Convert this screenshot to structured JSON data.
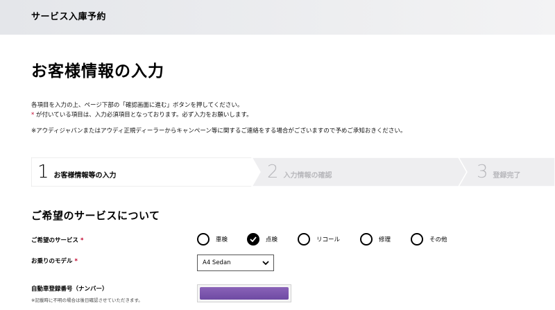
{
  "header": {
    "title": "サービス入庫予約"
  },
  "page": {
    "title": "お客様情報の入力",
    "intro_line1": "各項目を入力の上、ページ下部の「確認画面に進む」ボタンを押してください。",
    "intro_line2_star": "*",
    "intro_line2": "が付いている項目は、入力必須項目となっております。必ず入力をお願いします。",
    "intro_line3": "※アウディジャパンまたはアウディ正規ディーラーからキャンペーン等に関するご連絡をする場合がございますので予めご承知おきください。"
  },
  "steps": [
    {
      "number": "1",
      "label": "お客様情報等の入力",
      "state": "active"
    },
    {
      "number": "2",
      "label": "入力情報の確認",
      "state": "inactive"
    },
    {
      "number": "3",
      "label": "登録完了",
      "state": "inactive"
    }
  ],
  "section": {
    "title": "ご希望のサービスについて"
  },
  "form": {
    "service": {
      "label": "ご希望のサービス",
      "required_mark": "*",
      "options": [
        "車検",
        "点検",
        "リコール",
        "修理",
        "その他"
      ],
      "selected": "点検"
    },
    "model": {
      "label": "お乗りのモデル",
      "required_mark": "*",
      "value": "A4 Sedan"
    },
    "plate": {
      "label": "自動車登録番号（ナンバー）",
      "note": "※記載時に不明の場合は後日確認させていただきます。"
    }
  },
  "colors": {
    "required": "#c0002a",
    "step_inactive_text": "#b8b8bc",
    "plate_accent": "#7a55ad"
  }
}
